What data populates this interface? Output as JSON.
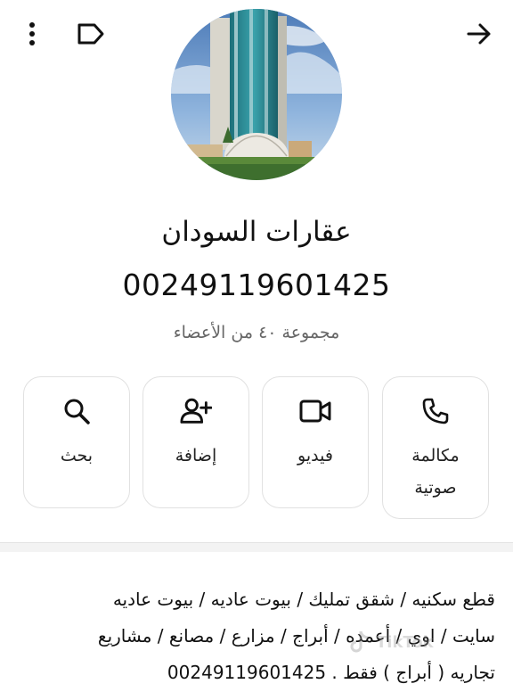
{
  "header": {
    "menu_icon": "more-vertical-icon",
    "label_icon": "label-tag-icon",
    "back_icon": "arrow-right-icon"
  },
  "profile": {
    "name": "عقارات السودان",
    "phone": "00249119601425",
    "meta": "مجموعة ٤٠ من الأعضاء"
  },
  "actions": {
    "search": {
      "label": "بحث",
      "icon": "search-icon"
    },
    "add": {
      "label": "إضافة",
      "icon": "person-add-icon"
    },
    "video": {
      "label": "فيديو",
      "icon": "video-camera-icon"
    },
    "call": {
      "label": "مكالمة\nصوتية",
      "icon": "phone-icon"
    }
  },
  "description": {
    "line1": "قطع سكنيه / شقق تمليك / بيوت عاديه / بيوت عاديه",
    "line2": "سايت / اوي / أعمده / أبراج / مزارع / مصانع / مشاريع",
    "line3": "تجاريه ( أبراج ) فقط .    00249119601425"
  },
  "watermark": {
    "text": "TikTok"
  },
  "colors": {
    "accent": "#111111",
    "muted": "#666666",
    "border": "#e1e1e1"
  }
}
